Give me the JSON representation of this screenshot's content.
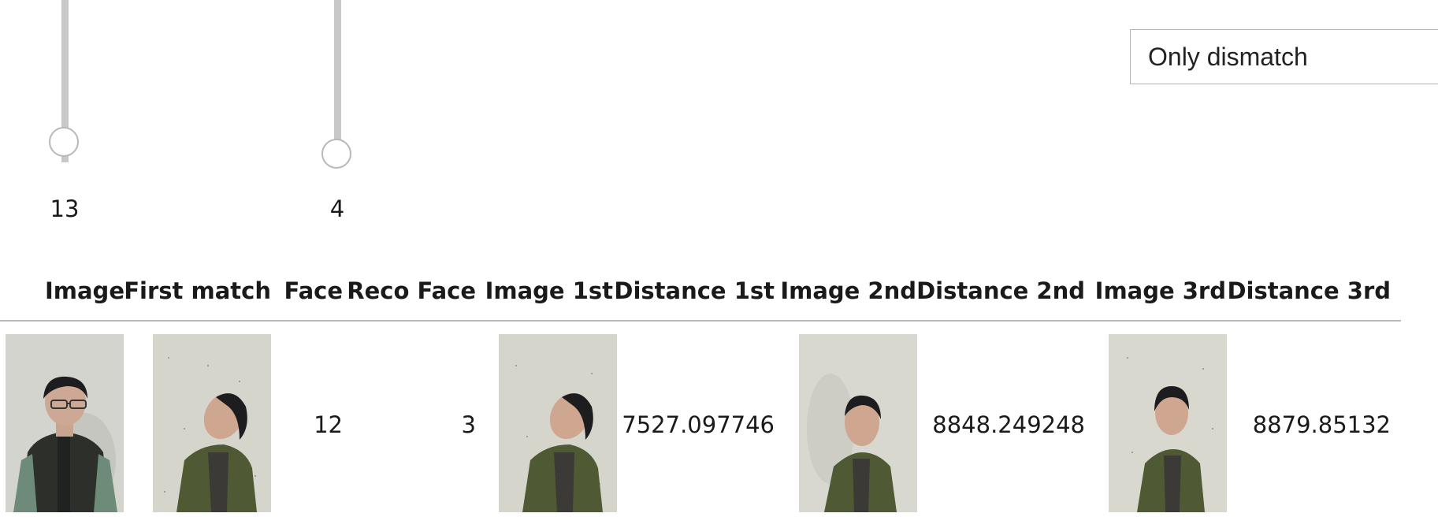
{
  "sliders": [
    {
      "value": "13",
      "level": 0.15
    },
    {
      "value": "4",
      "level": 0.12
    }
  ],
  "filter": {
    "selected": "Only dismatch"
  },
  "table": {
    "headers": [
      "Image",
      "First match",
      "Face",
      "Reco Face",
      "Image 1st",
      "Distance 1st",
      "Image 2nd",
      "Distance 2nd",
      "Image 3rd",
      "Distance 3rd"
    ],
    "rows": [
      {
        "face": "12",
        "reco_face": "3",
        "distance_1st": "7527.097746",
        "distance_2nd": "8848.249248",
        "distance_3rd": "8879.85132"
      }
    ]
  },
  "colors": {
    "photo_wall": "#d4d4c8",
    "jacket_green": "#4f5a34",
    "vest_dark": "#2c2f2a",
    "hair": "#1d1d1f",
    "skin": "#c9a48e"
  }
}
